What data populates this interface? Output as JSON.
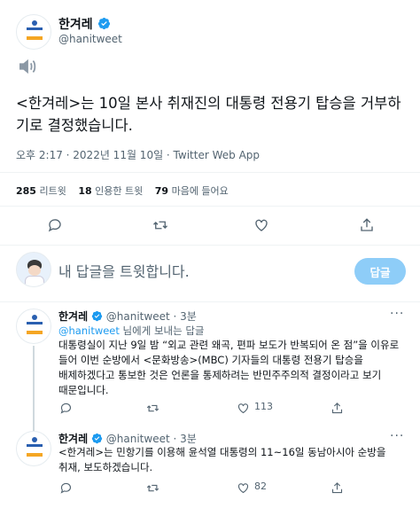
{
  "tweet": {
    "author_name": "한겨레",
    "author_handle": "@hanitweet",
    "text": "<한겨레>는 10일 본사 취재진의 대통령 전용기 탑승을 거부하기로 결정했습니다.",
    "meta": "오후 2:17 · 2022년 11월 10일 · Twitter Web App",
    "stats": {
      "retweets_count": "285",
      "retweets_label": "리트윗",
      "quotes_count": "18",
      "quotes_label": "인용한 트윗",
      "likes_count": "79",
      "likes_label": "마음에 들어요"
    }
  },
  "reply_box": {
    "placeholder": "내 답글을 트윗합니다.",
    "button_label": "답글"
  },
  "replies": [
    {
      "author_name": "한겨레",
      "author_handle": "@hanitweet",
      "time": "· 3분",
      "replying_to_handle": "@hanitweet",
      "replying_to_suffix": " 님에게 보내는 답글",
      "text": "대통령실이 지난 9일 밤 “외교 관련 왜곡, 편파 보도가 반복되어 온 점”을 이유로 들어 이번 순방에서 <문화방송>(MBC) 기자들의 대통령 전용기 탑승을 배제하겠다고 통보한 것은 언론을 통제하려는 반민주주의적 결정이라고 보기 때문입니다.",
      "likes": "113"
    },
    {
      "author_name": "한겨레",
      "author_handle": "@hanitweet",
      "time": "· 3분",
      "text": "<한겨레>는 민항기를 이용해 윤석열 대통령의 11~16일 동남아시아 순방을 취재, 보도하겠습니다.",
      "likes": "82"
    }
  ],
  "colors": {
    "accent": "#1d9bf0",
    "muted": "#536471",
    "reply_button_bg": "#8ecdf8"
  }
}
